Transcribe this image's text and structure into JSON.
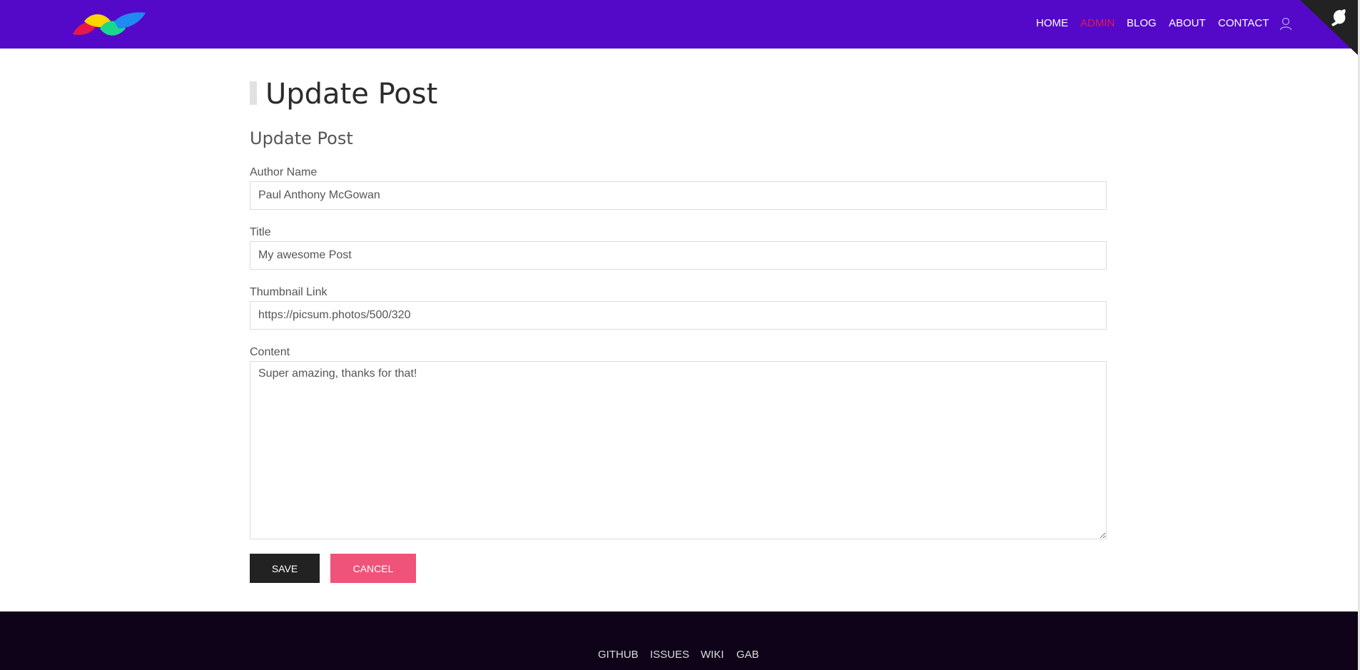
{
  "navbar": {
    "links": [
      {
        "label": "HOME",
        "active": false
      },
      {
        "label": "ADMIN",
        "active": true
      },
      {
        "label": "BLOG",
        "active": false
      },
      {
        "label": "ABOUT",
        "active": false
      },
      {
        "label": "CONTACT",
        "active": false
      }
    ],
    "user_icon": "user-icon",
    "corner_icon": "github-octocat-icon",
    "background_color": "#5409c8",
    "active_color": "#e8174a"
  },
  "main": {
    "page_title": "Update Post",
    "form_title": "Update Post",
    "fields": {
      "author": {
        "label": "Author Name",
        "value": "Paul Anthony McGowan"
      },
      "title": {
        "label": "Title",
        "value": "My awesome Post"
      },
      "thumbnail": {
        "label": "Thumbnail Link",
        "value": "https://picsum.photos/500/320"
      },
      "content": {
        "label": "Content",
        "value": "Super amazing, thanks for that!"
      }
    },
    "buttons": {
      "save_label": "SAVE",
      "cancel_label": "CANCEL",
      "save_color": "#222222",
      "cancel_color": "#ef5379"
    }
  },
  "footer": {
    "links": [
      "GITHUB",
      "ISSUES",
      "WIKI",
      "GAB"
    ],
    "background_color": "#0e0318"
  }
}
